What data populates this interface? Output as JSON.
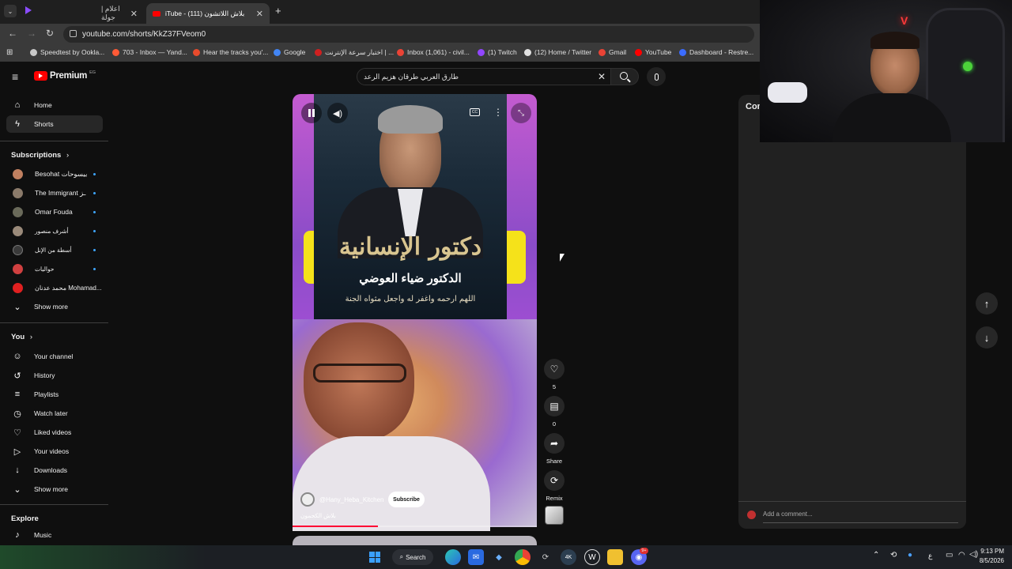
{
  "browser": {
    "tabs": [
      {
        "label": "اعلام | جولة",
        "close": "✕"
      },
      {
        "label": "iTube - بلاش اللاتشون (111)",
        "close": "✕"
      }
    ],
    "new_tab": "+",
    "url": "youtube.com/shorts/KkZ37FVeom0"
  },
  "bookmarks": [
    {
      "label": "Speedtest by Ookla...",
      "color": "#c8c8c8"
    },
    {
      "label": "703 - Inbox — Yand...",
      "color": "#ff5a36"
    },
    {
      "label": "Hear the tracks you'...",
      "color": "#e84b2c"
    },
    {
      "label": "Google",
      "color": "#4285f4"
    },
    {
      "label": "اختبار سرعة الإنترنت | ...",
      "color": "#d02020"
    },
    {
      "label": "Inbox (1,061) - civil...",
      "color": "#ea4335"
    },
    {
      "label": "(1) Twitch",
      "color": "#9146ff"
    },
    {
      "label": "(12) Home / Twitter",
      "color": "#e0e0e0"
    },
    {
      "label": "Gmail",
      "color": "#ea4335"
    },
    {
      "label": "YouTube",
      "color": "#ff0000"
    },
    {
      "label": "Dashboard - Restre...",
      "color": "#3b6cff"
    }
  ],
  "youtube": {
    "logo": "Premium",
    "logo_region": "EG",
    "search_value": "طارق العربي طرقان هزيم الرعد"
  },
  "sidebar": {
    "main": [
      {
        "label": "Home",
        "icon": "⌂"
      },
      {
        "label": "Shorts",
        "icon": "▶"
      }
    ],
    "subscriptions_header": "Subscriptions",
    "subscriptions": [
      {
        "label": "Besohat بيسوحات",
        "color": "#c08060"
      },
      {
        "label": "The Immigrant ـز",
        "color": "#8a7a6a"
      },
      {
        "label": "Omar Fouda",
        "color": "#6a6a5a"
      },
      {
        "label": "أشرف منصور",
        "color": "#9a8a7a"
      },
      {
        "label": "أسطة من الإنل",
        "color": "#3a3a3a"
      },
      {
        "label": "حواليات",
        "color": "#d04040"
      },
      {
        "label": "محمد عدنان Mohamad...",
        "color": "#e02020"
      }
    ],
    "subs_show_more": "Show more",
    "you_header": "You",
    "you": [
      {
        "label": "Your channel",
        "icon": "☺"
      },
      {
        "label": "History",
        "icon": "↺"
      },
      {
        "label": "Playlists",
        "icon": "≡"
      },
      {
        "label": "Watch later",
        "icon": "◷"
      },
      {
        "label": "Liked videos",
        "icon": "♡"
      },
      {
        "label": "Your videos",
        "icon": "▷"
      },
      {
        "label": "Downloads",
        "icon": "↓"
      }
    ],
    "you_show_more": "Show more",
    "explore_header": "Explore",
    "explore": [
      {
        "label": "Music",
        "icon": "♪"
      }
    ]
  },
  "short": {
    "overlay_title": "دكتور الإنسانية",
    "overlay_name": "الدكتور ضياء العوضي",
    "overlay_prayer": "اللهم ارحمه واغفر له واجعل مثواه الجنة",
    "channel": "@Hany_Heba_Kitchen",
    "subscribe": "Subscribe",
    "caption": "بلاش الكحمون",
    "actions": [
      {
        "icon": "♡",
        "label": "5"
      },
      {
        "icon": "▤",
        "label": "0"
      },
      {
        "icon": "➦",
        "label": "Share"
      },
      {
        "icon": "⟳",
        "label": "Remix"
      }
    ],
    "progress": 0.35
  },
  "comments": {
    "title": "Com",
    "add_placeholder": "Add a comment..."
  },
  "taskbar": {
    "search": "Search",
    "time": "9:13 PM",
    "date": "8/5/2026",
    "lang": "ع",
    "badge_discord": "9+"
  }
}
